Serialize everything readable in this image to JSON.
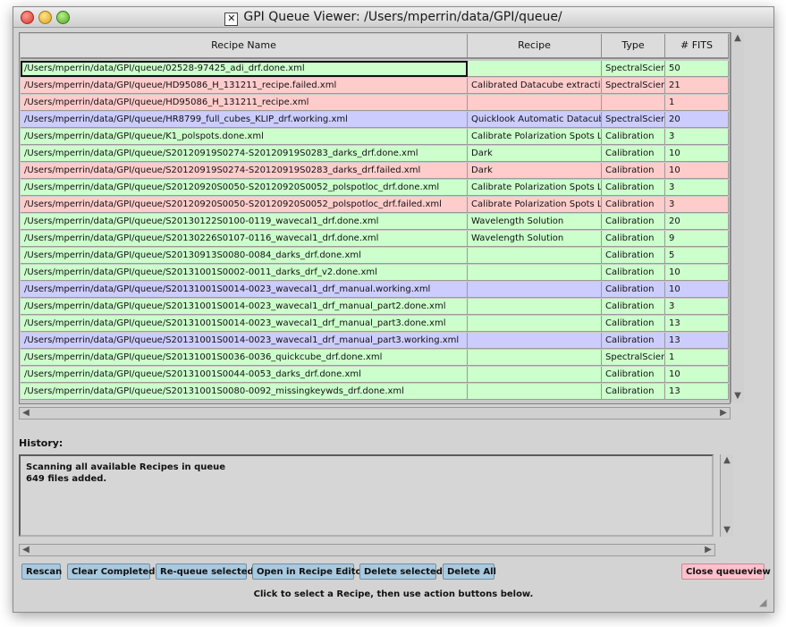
{
  "window": {
    "title": "GPI Queue Viewer: /Users/mperrin/data/GPI/queue/"
  },
  "table": {
    "columns": [
      "Recipe Name",
      "Recipe",
      "Type",
      "# FITS"
    ],
    "rows": [
      {
        "name": "/Users/mperrin/data/GPI/queue/02528-97425_adi_drf.done.xml",
        "recipe": "",
        "type": "SpectralScien",
        "fits": "50",
        "status": "done"
      },
      {
        "name": "/Users/mperrin/data/GPI/queue/HD95086_H_131211_recipe.failed.xml",
        "recipe": "Calibrated Datacube extraction",
        "type": "SpectralScien",
        "fits": "21",
        "status": "failed"
      },
      {
        "name": "/Users/mperrin/data/GPI/queue/HD95086_H_131211_recipe.xml",
        "recipe": "",
        "type": "",
        "fits": "1",
        "status": "failed"
      },
      {
        "name": "/Users/mperrin/data/GPI/queue/HR8799_full_cubes_KLIP_drf.working.xml",
        "recipe": "Quicklook Automatic Datacube I",
        "type": "SpectralScien",
        "fits": "20",
        "status": "working"
      },
      {
        "name": "/Users/mperrin/data/GPI/queue/K1_polspots.done.xml",
        "recipe": "Calibrate Polarization Spots Lo",
        "type": "Calibration",
        "fits": "3",
        "status": "done"
      },
      {
        "name": "/Users/mperrin/data/GPI/queue/S20120919S0274-S20120919S0283_darks_drf.done.xml",
        "recipe": "Dark",
        "type": "Calibration",
        "fits": "10",
        "status": "done"
      },
      {
        "name": "/Users/mperrin/data/GPI/queue/S20120919S0274-S20120919S0283_darks_drf.failed.xml",
        "recipe": "Dark",
        "type": "Calibration",
        "fits": "10",
        "status": "failed"
      },
      {
        "name": "/Users/mperrin/data/GPI/queue/S20120920S0050-S20120920S0052_polspotloc_drf.done.xml",
        "recipe": "Calibrate Polarization Spots Lo",
        "type": "Calibration",
        "fits": "3",
        "status": "done"
      },
      {
        "name": "/Users/mperrin/data/GPI/queue/S20120920S0050-S20120920S0052_polspotloc_drf.failed.xml",
        "recipe": "Calibrate Polarization Spots Lo",
        "type": "Calibration",
        "fits": "3",
        "status": "failed"
      },
      {
        "name": "/Users/mperrin/data/GPI/queue/S20130122S0100-0119_wavecal1_drf.done.xml",
        "recipe": "Wavelength Solution",
        "type": "Calibration",
        "fits": "20",
        "status": "done"
      },
      {
        "name": "/Users/mperrin/data/GPI/queue/S20130226S0107-0116_wavecal1_drf.done.xml",
        "recipe": "Wavelength Solution",
        "type": "Calibration",
        "fits": "9",
        "status": "done"
      },
      {
        "name": "/Users/mperrin/data/GPI/queue/S20130913S0080-0084_darks_drf.done.xml",
        "recipe": "",
        "type": "Calibration",
        "fits": "5",
        "status": "done"
      },
      {
        "name": "/Users/mperrin/data/GPI/queue/S20131001S0002-0011_darks_drf_v2.done.xml",
        "recipe": "",
        "type": "Calibration",
        "fits": "10",
        "status": "done"
      },
      {
        "name": "/Users/mperrin/data/GPI/queue/S20131001S0014-0023_wavecal1_drf_manual.working.xml",
        "recipe": "",
        "type": "Calibration",
        "fits": "10",
        "status": "working"
      },
      {
        "name": "/Users/mperrin/data/GPI/queue/S20131001S0014-0023_wavecal1_drf_manual_part2.done.xml",
        "recipe": "",
        "type": "Calibration",
        "fits": "3",
        "status": "done"
      },
      {
        "name": "/Users/mperrin/data/GPI/queue/S20131001S0014-0023_wavecal1_drf_manual_part3.done.xml",
        "recipe": "",
        "type": "Calibration",
        "fits": "13",
        "status": "done"
      },
      {
        "name": "/Users/mperrin/data/GPI/queue/S20131001S0014-0023_wavecal1_drf_manual_part3.working.xml",
        "recipe": "",
        "type": "Calibration",
        "fits": "13",
        "status": "working"
      },
      {
        "name": "/Users/mperrin/data/GPI/queue/S20131001S0036-0036_quickcube_drf.done.xml",
        "recipe": "",
        "type": "SpectralScien",
        "fits": "1",
        "status": "done"
      },
      {
        "name": "/Users/mperrin/data/GPI/queue/S20131001S0044-0053_darks_drf.done.xml",
        "recipe": "",
        "type": "Calibration",
        "fits": "10",
        "status": "done"
      },
      {
        "name": "/Users/mperrin/data/GPI/queue/S20131001S0080-0092_missingkeywds_drf.done.xml",
        "recipe": "",
        "type": "Calibration",
        "fits": "13",
        "status": "done"
      }
    ]
  },
  "history": {
    "label": "History:",
    "lines": [
      "Scanning all available Recipes in queue",
      "649 files added."
    ]
  },
  "buttons": {
    "rescan": "Rescan",
    "clear_completed": "Clear Completed",
    "requeue": "Re-queue selected",
    "open_editor": "Open in Recipe Editor",
    "delete_selected": "Delete selected",
    "delete_all": "Delete All",
    "close": "Close queueview"
  },
  "hint": "Click to select a Recipe, then use action buttons below.",
  "colors": {
    "done": "#ccffcc",
    "failed": "#ffcccc",
    "working": "#ccccff",
    "button": "#a9c9df",
    "close_button": "#ffc0cb"
  }
}
